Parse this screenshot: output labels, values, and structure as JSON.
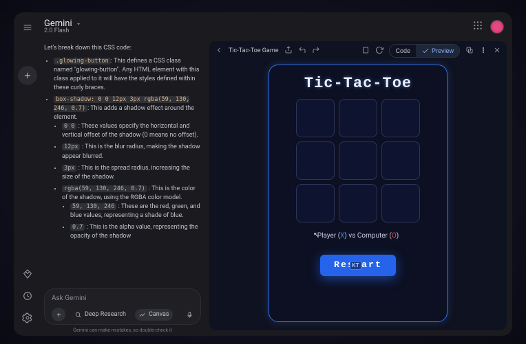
{
  "header": {
    "brand": "Gemini",
    "sub": "2.0 Flash"
  },
  "chat": {
    "intro": "Let's break down this CSS code:",
    "b1_code": ".glowing-button",
    "b1_text": ": This defines a CSS class named \"glowing-button\". Any HTML element with this class applied to it will have the styles defined within these curly braces.",
    "b2_code": "box-shadow: 0 0 12px 3px rgba(59, 130, 246, 0.7)",
    "b2_text": ": This adds a shadow effect around the element.",
    "b2a_code": "0 0",
    "b2a_text": " : These values specify the horizontal and vertical offset of the shadow (0 means no offset).",
    "b2b_code": "12px",
    "b2b_text": " : This is the blur radius, making the shadow appear blurred.",
    "b2c_code": "3px",
    "b2c_text": " : This is the spread radius, increasing the size of the shadow.",
    "b2d_code": "rgba(59, 130, 246, 0.7)",
    "b2d_text": " : This is the color of the shadow, using the RGBA color model.",
    "b2d1_code": "59, 130, 246",
    "b2d1_text": " : These are the red, green, and blue values, representing a shade of blue.",
    "b2d2_code": "0.7",
    "b2d2_text": " : This is the alpha value, representing the opacity of the shadow",
    "ask_placeholder": "Ask Gemini",
    "deep_research": "Deep Research",
    "canvas_label": "Canvas",
    "disclaimer": "Gemini can make mistakes, so double-check it"
  },
  "canvas": {
    "tab_title": "Tic-Tac-Toe Game",
    "code_label": "Code",
    "preview_label": "Preview"
  },
  "game": {
    "title": "Tic-Tac-Toe",
    "status_prefix": "Player (",
    "status_x": "X",
    "status_mid": ") vs Computer (",
    "status_o": "O",
    "status_suffix": ")",
    "restart": "Restart",
    "kt": "KT"
  }
}
